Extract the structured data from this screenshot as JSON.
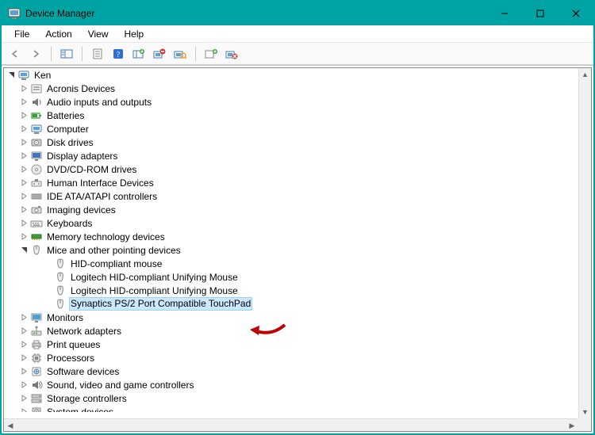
{
  "window": {
    "title": "Device Manager"
  },
  "menu": {
    "file": "File",
    "action": "Action",
    "view": "View",
    "help": "Help"
  },
  "toolbar_icons": [
    "back",
    "forward",
    "sep",
    "show-hide",
    "sep",
    "properties",
    "help",
    "update",
    "uninstall",
    "scan",
    "sep",
    "legacy",
    "disable"
  ],
  "tree": {
    "root": "Ken",
    "root_expanded": true,
    "categories": [
      {
        "label": "Acronis Devices",
        "icon": "generic",
        "expanded": false
      },
      {
        "label": "Audio inputs and outputs",
        "icon": "audio",
        "expanded": false
      },
      {
        "label": "Batteries",
        "icon": "battery",
        "expanded": false
      },
      {
        "label": "Computer",
        "icon": "computer",
        "expanded": false
      },
      {
        "label": "Disk drives",
        "icon": "disk",
        "expanded": false
      },
      {
        "label": "Display adapters",
        "icon": "display",
        "expanded": false
      },
      {
        "label": "DVD/CD-ROM drives",
        "icon": "optical",
        "expanded": false
      },
      {
        "label": "Human Interface Devices",
        "icon": "hid",
        "expanded": false
      },
      {
        "label": "IDE ATA/ATAPI controllers",
        "icon": "ide",
        "expanded": false
      },
      {
        "label": "Imaging devices",
        "icon": "imaging",
        "expanded": false
      },
      {
        "label": "Keyboards",
        "icon": "keyboard",
        "expanded": false
      },
      {
        "label": "Memory technology devices",
        "icon": "memory",
        "expanded": false
      },
      {
        "label": "Mice and other pointing devices",
        "icon": "mouse",
        "expanded": true,
        "children": [
          {
            "label": "HID-compliant mouse",
            "icon": "mouse",
            "selected": false
          },
          {
            "label": "Logitech HID-compliant Unifying Mouse",
            "icon": "mouse",
            "selected": false
          },
          {
            "label": "Logitech HID-compliant Unifying Mouse",
            "icon": "mouse",
            "selected": false
          },
          {
            "label": "Synaptics PS/2 Port Compatible TouchPad",
            "icon": "mouse",
            "selected": true
          }
        ]
      },
      {
        "label": "Monitors",
        "icon": "monitor",
        "expanded": false
      },
      {
        "label": "Network adapters",
        "icon": "network",
        "expanded": false
      },
      {
        "label": "Print queues",
        "icon": "printer",
        "expanded": false
      },
      {
        "label": "Processors",
        "icon": "cpu",
        "expanded": false
      },
      {
        "label": "Software devices",
        "icon": "software",
        "expanded": false
      },
      {
        "label": "Sound, video and game controllers",
        "icon": "sound",
        "expanded": false
      },
      {
        "label": "Storage controllers",
        "icon": "storage",
        "expanded": false
      },
      {
        "label": "System devices",
        "icon": "system",
        "expanded": false,
        "cut": true
      }
    ]
  }
}
